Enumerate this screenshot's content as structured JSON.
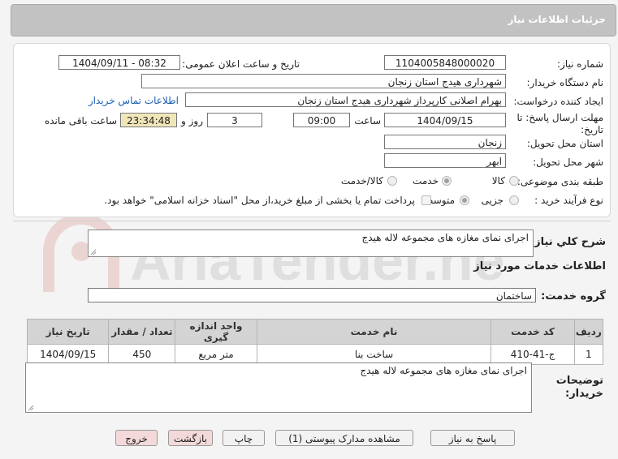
{
  "header": {
    "title": "جزئیات اطلاعات نیاز"
  },
  "watermark": {
    "text": "AriaTender.net"
  },
  "form": {
    "need_number": {
      "label": "شماره نیاز:",
      "value": "1104005848000020"
    },
    "announce_datetime": {
      "label": "تاریخ و ساعت اعلان عمومی:",
      "value": "1404/09/11 - 08:32"
    },
    "buyer_org": {
      "label": "نام دستگاه خریدار:",
      "value": "شهرداری هیدج استان زنجان"
    },
    "requester": {
      "label": "ایجاد کننده درخواست:",
      "value": "بهرام اصلانی کارپرداز شهرداری هیدج استان زنجان",
      "contact_link": "اطلاعات تماس خریدار"
    },
    "deadline": {
      "label": "مهلت ارسال پاسخ: تا تاریخ:",
      "date": "1404/09/15",
      "time_label": "ساعت",
      "time": "09:00",
      "days": "3",
      "days_label": "روز و",
      "remaining": "23:34:48",
      "remaining_label": "ساعت باقی مانده"
    },
    "delivery_province": {
      "label": "استان محل تحویل:",
      "value": "زنجان"
    },
    "delivery_city": {
      "label": "شهر محل تحویل:",
      "value": "ابهر"
    },
    "category": {
      "label": "طبقه بندی موضوعی:",
      "options": [
        "کالا",
        "خدمت",
        "کالا/خدمت"
      ],
      "selected": "خدمت"
    },
    "process": {
      "label": "نوع فرآیند خرید :",
      "options": [
        "جزیی",
        "متوسط"
      ],
      "selected": "جزیی",
      "checkbox_text": "پرداخت تمام یا بخشی از مبلغ خرید،از محل \"اسناد خزانه اسلامی\" خواهد بود."
    }
  },
  "summary": {
    "label": "شرح کلي نياز:",
    "value": "اجرای نمای مغازه های مجموعه لاله هیدج"
  },
  "services_title": "اطلاعات خدمات مورد نیاز",
  "service_group": {
    "label": "گروه خدمت:",
    "value": "ساختمان"
  },
  "table": {
    "headers": [
      "ردیف",
      "کد خدمت",
      "نام خدمت",
      "واحد اندازه گیری",
      "تعداد / مقدار",
      "تاریخ نیاز"
    ],
    "rows": [
      [
        "1",
        "ج-41-410",
        "ساخت بنا",
        "متر مربع",
        "450",
        "1404/09/15"
      ]
    ]
  },
  "buyer_notes": {
    "label": "توضیحات خریدار:",
    "value": "اجرای نمای مغازه های مجموعه لاله هیدج"
  },
  "buttons": {
    "reply": "پاسخ به نیاز",
    "attachments": "مشاهده مدارک پیوستی (1)",
    "print": "چاپ",
    "back": "بازگشت",
    "exit": "خروج"
  }
}
